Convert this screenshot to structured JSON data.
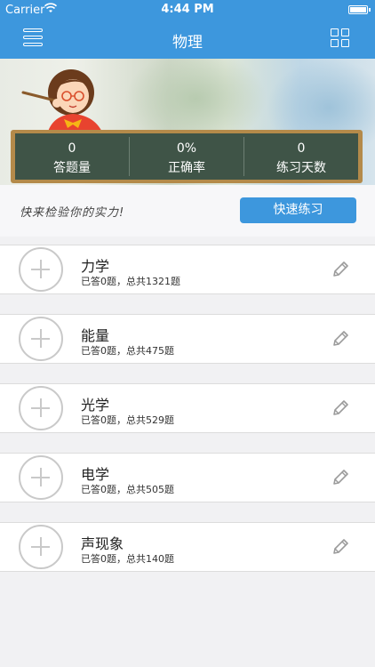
{
  "status_bar": {
    "carrier": "Carrier",
    "time": "4:44 PM"
  },
  "nav": {
    "title": "物理",
    "left_icon": "menu-icon",
    "right_icon": "grid-icon"
  },
  "stats": [
    {
      "value": "0",
      "label": "答题量"
    },
    {
      "value": "0%",
      "label": "正确率"
    },
    {
      "value": "0",
      "label": "练习天数"
    }
  ],
  "quick": {
    "prompt": "快来检验你的实力!",
    "button_label": "快速练习"
  },
  "subjects": [
    {
      "name": "力学",
      "progress": "已答0题，总共1321题"
    },
    {
      "name": "能量",
      "progress": "已答0题，总共475题"
    },
    {
      "name": "光学",
      "progress": "已答0题，总共529题"
    },
    {
      "name": "电学",
      "progress": "已答0题，总共505题"
    },
    {
      "name": "声现象",
      "progress": "已答0题，总共140题"
    }
  ],
  "colors": {
    "brand": "#3d97dd",
    "board": "#3f5447",
    "frame": "#b48a4a"
  }
}
